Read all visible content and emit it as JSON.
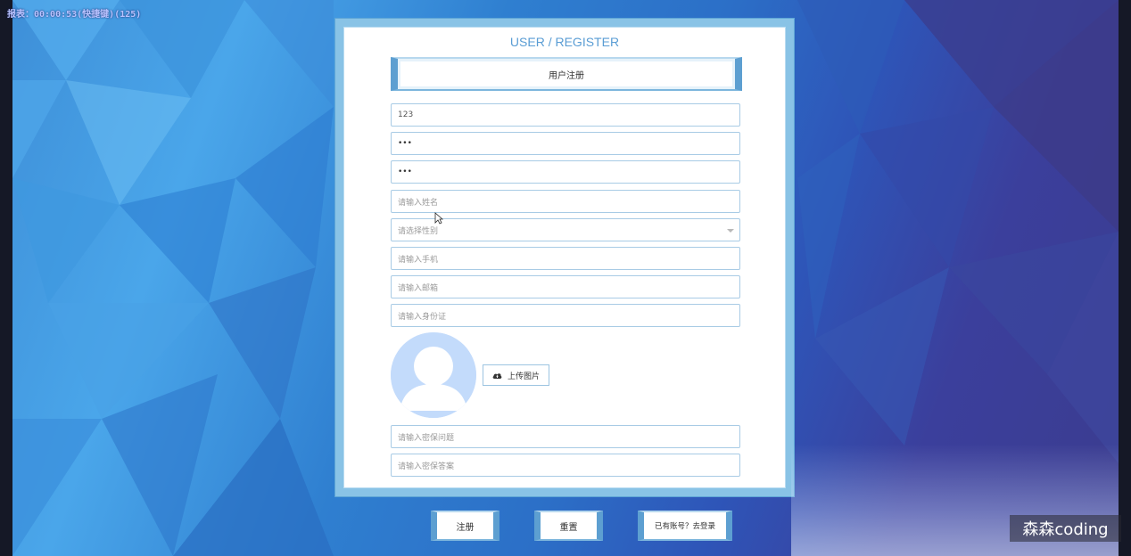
{
  "recording": {
    "timer_text": "报表：00:00:53(快捷键)(125)"
  },
  "form": {
    "title": "USER / REGISTER",
    "subtitle": "用户注册",
    "fields": [
      {
        "name": "username-field",
        "value": "123",
        "placeholder": ""
      },
      {
        "name": "password-field",
        "value": "•••",
        "placeholder": ""
      },
      {
        "name": "confirm-password-field",
        "value": "•••",
        "placeholder": ""
      },
      {
        "name": "name-field",
        "value": "",
        "placeholder": "请输入姓名"
      },
      {
        "name": "gender-select",
        "value": "",
        "placeholder": "请选择性别"
      },
      {
        "name": "phone-field",
        "value": "",
        "placeholder": "请输入手机"
      },
      {
        "name": "email-field",
        "value": "",
        "placeholder": "请输入邮箱"
      },
      {
        "name": "id-card-field",
        "value": "",
        "placeholder": "请输入身份证"
      },
      {
        "name": "security-question-field",
        "value": "",
        "placeholder": "请输入密保问题"
      },
      {
        "name": "security-answer-field",
        "value": "",
        "placeholder": "请输入密保答案"
      }
    ],
    "upload_label": "上传图片",
    "icons": {
      "upload": "cloud-upload-icon",
      "avatar": "user-avatar-icon",
      "select": "chevron-down-icon"
    }
  },
  "actions": {
    "register": "注册",
    "reset": "重置",
    "login_link": "已有账号？去登录"
  },
  "watermark": "森森coding",
  "colors": {
    "accent": "#5d9fd1",
    "title": "#5a9dd4",
    "avatar_bg": "#c5dcfb"
  }
}
